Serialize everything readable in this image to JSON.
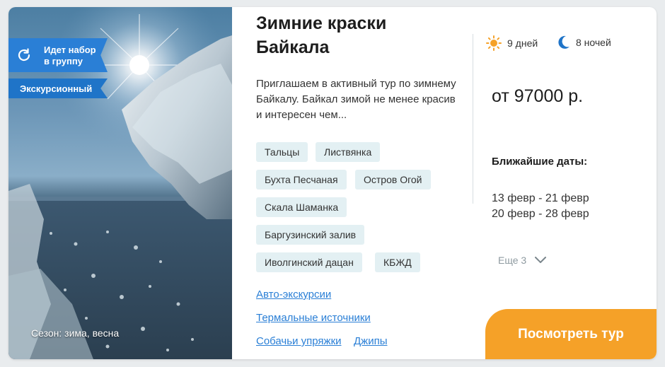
{
  "card": {
    "badge_group": "Идет набор в группу",
    "badge_type": "Экскурсионный",
    "season": "Сезон: зима, весна",
    "title": "Зимние краски Байкала",
    "description": "Приглашаем в активный тур по зимнему Байкалу. Байкал зимой не менее красив и интересен чем...",
    "tags": [
      "Тальцы",
      "Листвянка",
      "Бухта Песчаная",
      "Остров Огой",
      "Скала Шаманка",
      "Баргузинский залив",
      "Иволгинский дацан",
      "КБЖД"
    ],
    "links": [
      "Авто-экскурсии",
      "Термальные источники",
      "Собачьи упряжки",
      "Джипы"
    ],
    "days": "9 дней",
    "nights": "8 ночей",
    "price": "от 97000 р.",
    "dates_title": "Ближайшие даты:",
    "dates": [
      "13 февр - 21 февр",
      "20 февр - 28 февр"
    ],
    "more": "Еще 3",
    "cta": "Посмотреть тур"
  },
  "icons": {
    "refresh": "refresh-icon",
    "sun": "sun-icon",
    "moon": "moon-icon",
    "chevron": "chevron-down-icon"
  },
  "colors": {
    "accent_orange": "#f5a128",
    "badge_blue": "#2a7fd6",
    "tag_bg": "#e3f0f3",
    "link_blue": "#2a7fd6"
  }
}
